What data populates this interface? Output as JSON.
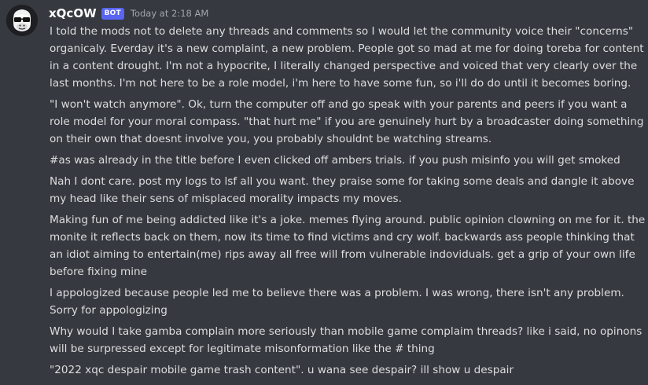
{
  "message": {
    "username": "xQcOW",
    "bot_tag": "BOT",
    "timestamp": "Today at 2:18 AM",
    "avatar_icon": "gorilla-sunglasses-avatar",
    "paragraphs": [
      "I told the mods not to delete any threads and comments so I would let the  community voice their \"concerns\" organicaly. Everday it's a new complaint, a new problem. People got so mad at me for doing toreba for content in a content drought. I'm not a hypocrite, I literally changed perspective and voiced that very clearly over the last months. I'm not here to be a role model, i'm here to have some fun, so i'll do do until it becomes boring.",
      "\"I won't watch anymore\". Ok, turn the computer off and go speak with your parents and peers if you want a role model for your moral compass. \"that hurt me\" if you are genuinely hurt by a broadcaster doing something on their own that doesnt involve you, you probably shouldnt be watching streams.",
      "#as was already in the title before I even clicked off ambers trials. if you push misinfo you will get smoked",
      "Nah I dont care. post my logs to lsf all you want. they praise some for taking some deals and dangle it above my head like their sens of misplaced morality impacts my moves.",
      "Making fun of me being addicted like it's a joke. memes flying around. public opinion clowning on me for it. the monite it reflects back on them, now its time to find victims and cry wolf. backwards ass people thinking that an idiot aiming to entertain(me) rips away all free will from vulnerable indoviduals. get a grip of your own life before fixing mine",
      "I appologized because people led me to believe there was a problem. I was wrong, there isn't any problem. Sorry for appologizing",
      "Why would I take gamba complain more seriously than mobile game complaim threads? like i said, no opinons will be surpressed except for legitimate misonformation like the # thing",
      "\"2022 xqc despair mobile game trash content\". u wana see despair? ill show u despair"
    ]
  },
  "colors": {
    "background": "#36393f",
    "text": "#dcddde",
    "username": "#ffffff",
    "bot_tag_bg": "#5865f2",
    "timestamp": "#a3a6aa"
  }
}
